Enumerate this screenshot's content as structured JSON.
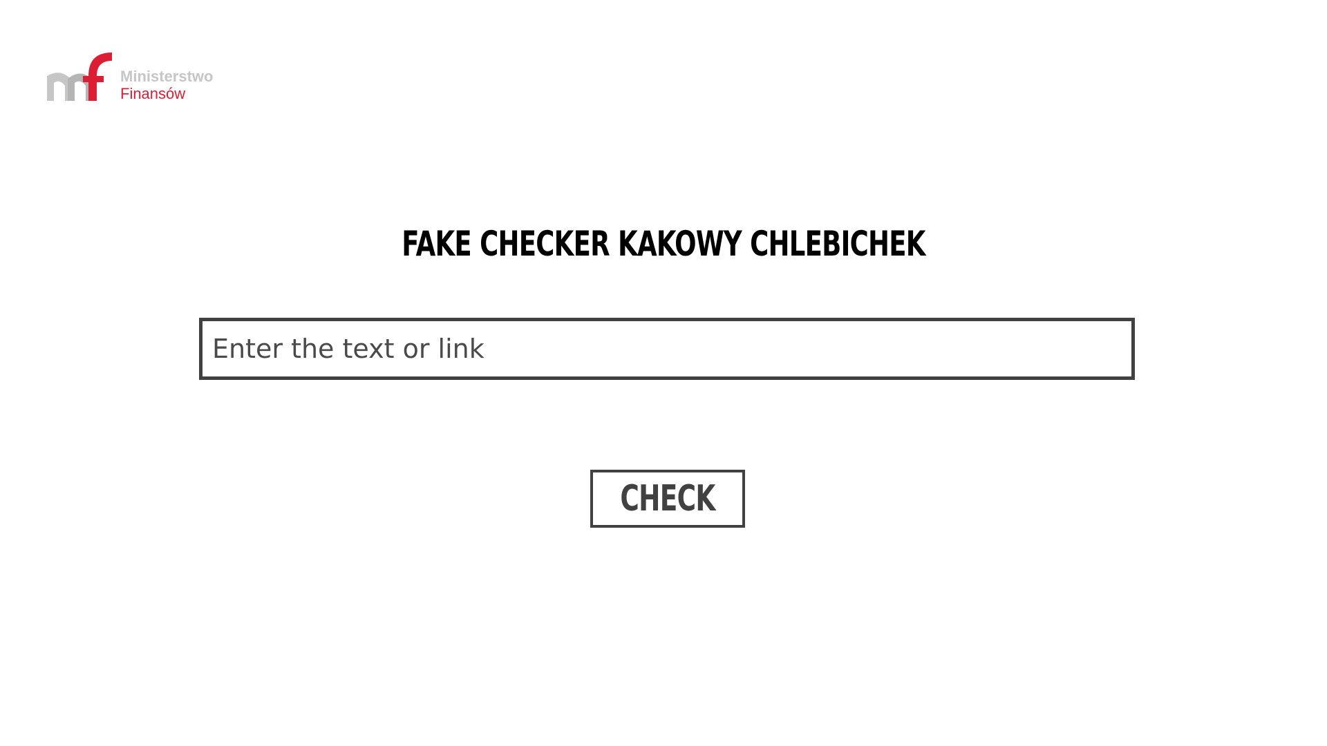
{
  "header": {
    "logo": {
      "line1": "Ministerstwo",
      "line2": "Finansów",
      "colors": {
        "gray": "#c6c6c6",
        "red": "#dc1e35"
      }
    }
  },
  "main": {
    "title": "FAKE CHECKER KAKOWY CHLEBICHEK",
    "search": {
      "placeholder": "Enter the text or link",
      "value": ""
    },
    "check_button": {
      "label": "CHECK"
    }
  },
  "colors": {
    "border": "#414141",
    "title": "#000000",
    "background": "#ffffff"
  }
}
